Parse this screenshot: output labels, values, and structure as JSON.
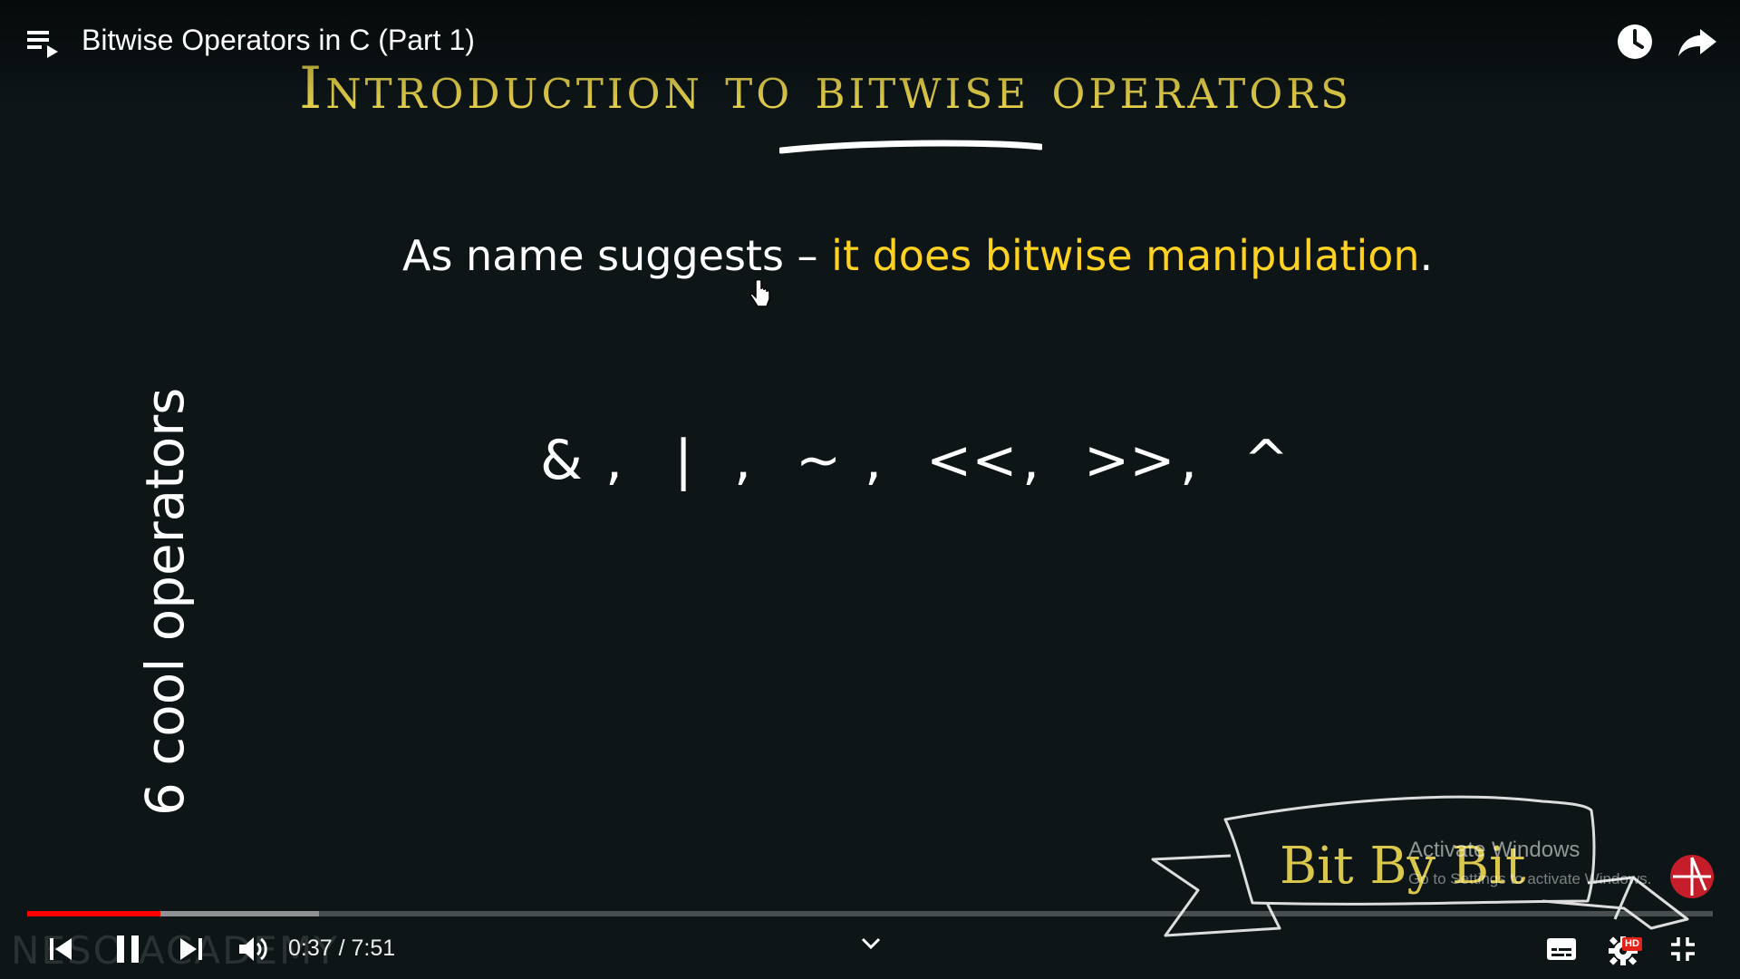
{
  "header": {
    "title": "Bitwise Operators in C (Part 1)",
    "playlist_icon": "playlist-icon",
    "watch_later_icon": "clock-icon",
    "share_icon": "share-arrow-icon"
  },
  "slide": {
    "heading": "Introduction to bitwise operators",
    "subtitle_plain": "As name suggests – ",
    "subtitle_highlight": "it does bitwise manipulation",
    "subtitle_end": ".",
    "operators": [
      "&",
      ",",
      "|",
      ",",
      "~",
      ",",
      "<<",
      ",",
      ">>",
      ",",
      "^"
    ],
    "vertical_label": "6 cool operators",
    "banner_text": "Bit By Bit",
    "colors": {
      "heading": "#e3cf4a",
      "highlight": "#ffd21f",
      "background": "#0d1517"
    }
  },
  "overlay": {
    "activate_title": "Activate Windows",
    "activate_sub": "Go to Settings to activate Windows."
  },
  "watermark": "NESO ACADEMY",
  "player": {
    "current_time": "0:37",
    "separator": " / ",
    "duration": "7:51",
    "played_fraction": 0.079,
    "buffered_fraction": 0.173,
    "hd_label": "HD",
    "progress_color": "#ff0000"
  }
}
